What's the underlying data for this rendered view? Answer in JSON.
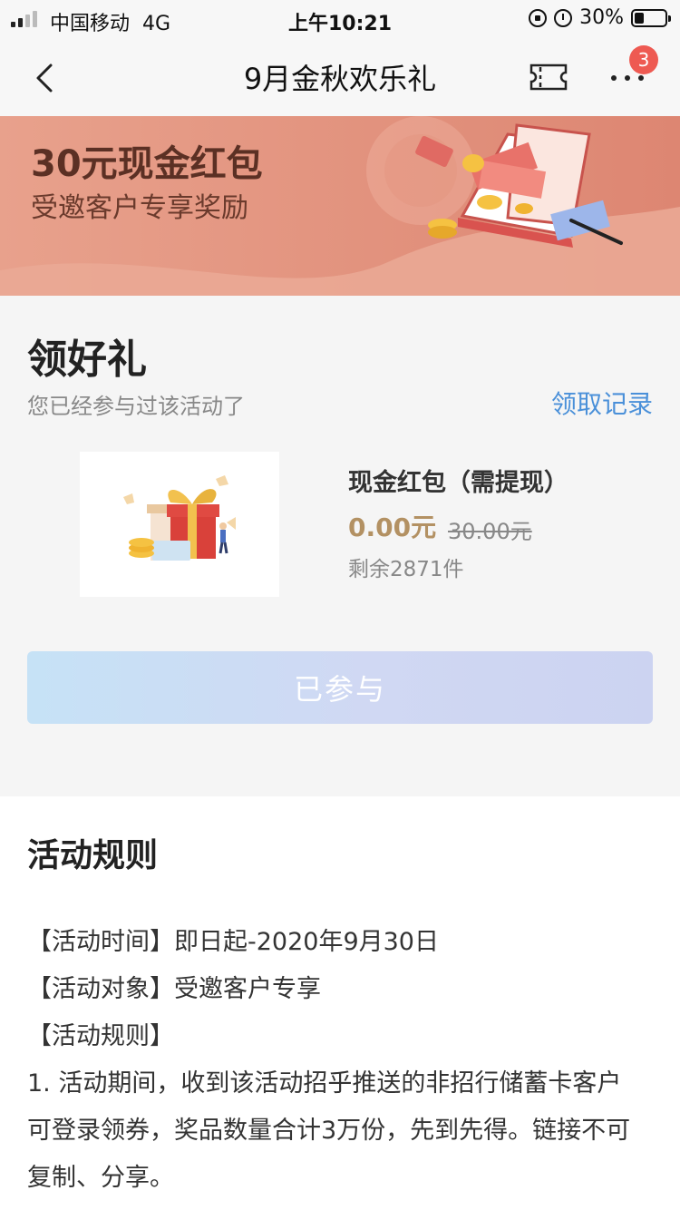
{
  "status_bar": {
    "carrier": "中国移动",
    "network": "4G",
    "time": "上午10:21",
    "battery": "30%",
    "battery_level": 0.3
  },
  "nav": {
    "title": "9月金秋欢乐礼",
    "more_badge": "3"
  },
  "banner": {
    "title": "30元现金红包",
    "subtitle": "受邀客户专享奖励"
  },
  "gift": {
    "section_title": "领好礼",
    "joined_note": "您已经参与过该活动了",
    "record_link": "领取记录",
    "prize_name": "现金红包（需提现）",
    "price": "0.00元",
    "original_price": "30.00元",
    "remaining": "剩余2871件",
    "button_label": "已参与"
  },
  "rules": {
    "title": "活动规则",
    "lines": [
      "【活动时间】即日起-2020年9月30日",
      "【活动对象】受邀客户专享",
      "【活动规则】",
      "1. 活动期间，收到该活动招乎推送的非招行储蓄卡客户",
      "可登录领券，奖品数量合计3万份，先到先得。链接不可",
      "复制、分享。"
    ]
  },
  "colors": {
    "banner": "#e9a28c",
    "link": "#4a90d9",
    "price": "#b39163",
    "badge": "#ee5a52"
  }
}
